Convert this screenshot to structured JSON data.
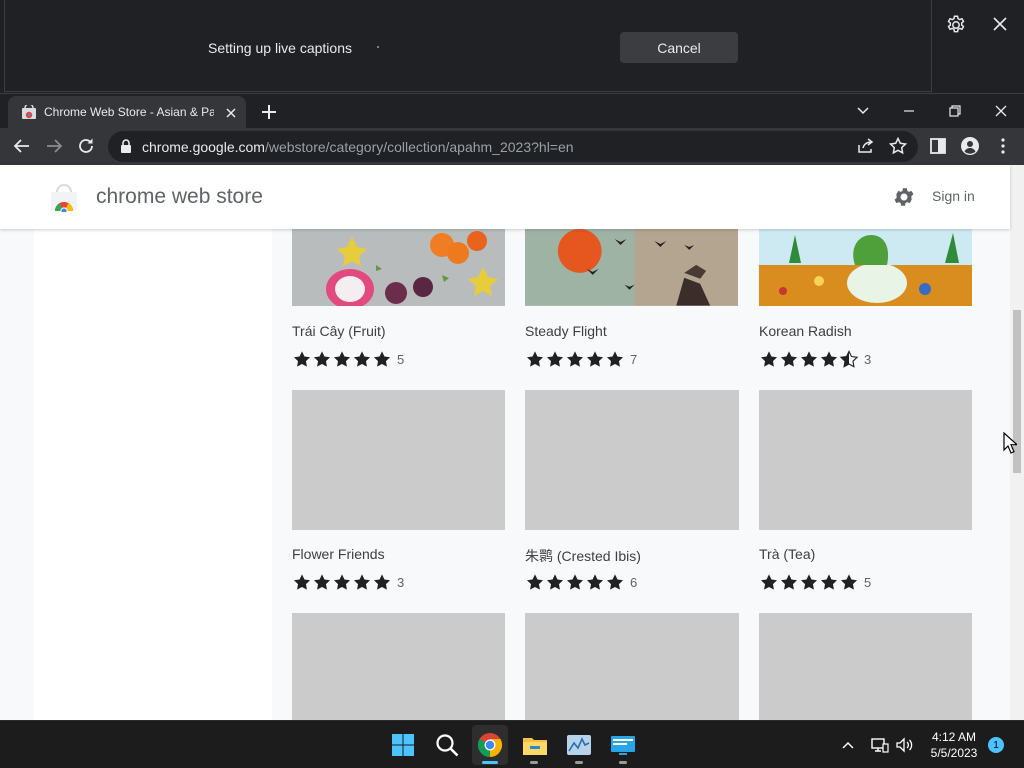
{
  "captions": {
    "status_text": "Setting up live captions",
    "cancel_label": "Cancel"
  },
  "browser": {
    "tab_title": "Chrome Web Store - Asian & Pac",
    "url_host": "chrome.google.com",
    "url_path": "/webstore/category/collection/apahm_2023?hl=en"
  },
  "store": {
    "title": "chrome web store",
    "signin_label": "Sign in",
    "items": [
      {
        "name": "Trái Cây (Fruit)",
        "rating": 5,
        "count": "5"
      },
      {
        "name": "Steady Flight",
        "rating": 5,
        "count": "7"
      },
      {
        "name": "Korean Radish",
        "rating": 4.5,
        "count": "3"
      },
      {
        "name": "Flower Friends",
        "rating": 5,
        "count": "3"
      },
      {
        "name": "朱鹮 (Crested Ibis)",
        "rating": 5,
        "count": "6"
      },
      {
        "name": "Trà (Tea)",
        "rating": 5,
        "count": "5"
      }
    ]
  },
  "taskbar": {
    "time": "4:12 AM",
    "date": "5/5/2023",
    "notification_count": "1"
  },
  "colors": {
    "chrome_dark": "#202124",
    "toolbar": "#35363a",
    "thumb_placeholder": "#cbcbcb",
    "accent_blue": "#4cc2ff"
  }
}
